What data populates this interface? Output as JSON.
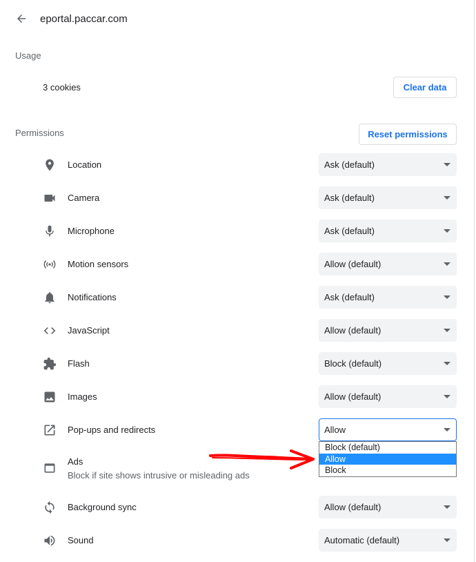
{
  "header": {
    "title": "eportal.paccar.com",
    "back_icon": "arrow-back-icon"
  },
  "usage": {
    "label": "Usage",
    "cookies": "3 cookies",
    "clear_button": "Clear data"
  },
  "permissions": {
    "label": "Permissions",
    "reset_button": "Reset permissions",
    "items": [
      {
        "name": "Location",
        "icon": "location-pin-icon",
        "value": "Ask (default)"
      },
      {
        "name": "Camera",
        "icon": "camera-icon",
        "value": "Ask (default)"
      },
      {
        "name": "Microphone",
        "icon": "microphone-icon",
        "value": "Ask (default)"
      },
      {
        "name": "Motion sensors",
        "icon": "motion-sensors-icon",
        "value": "Allow (default)"
      },
      {
        "name": "Notifications",
        "icon": "bell-icon",
        "value": "Ask (default)"
      },
      {
        "name": "JavaScript",
        "icon": "code-icon",
        "value": "Allow (default)"
      },
      {
        "name": "Flash",
        "icon": "puzzle-icon",
        "value": "Block (default)"
      },
      {
        "name": "Images",
        "icon": "image-icon",
        "value": "Allow (default)"
      },
      {
        "name": "Pop-ups and redirects",
        "icon": "open-in-new-icon",
        "value": "Allow"
      },
      {
        "name": "Ads",
        "icon": "ads-window-icon",
        "sublabel": "Block if site shows intrusive or misleading ads"
      },
      {
        "name": "Background sync",
        "icon": "sync-icon",
        "value": "Allow (default)"
      },
      {
        "name": "Sound",
        "icon": "speaker-icon",
        "value": "Automatic (default)"
      }
    ]
  },
  "dropdown": {
    "options": [
      "Block (default)",
      "Allow",
      "Block"
    ],
    "selected": "Allow"
  },
  "colors": {
    "accent": "#1a73e8",
    "select_bg": "#f1f3f4",
    "highlight": "#1e90ff",
    "annotation_arrow": "#ff0000"
  }
}
